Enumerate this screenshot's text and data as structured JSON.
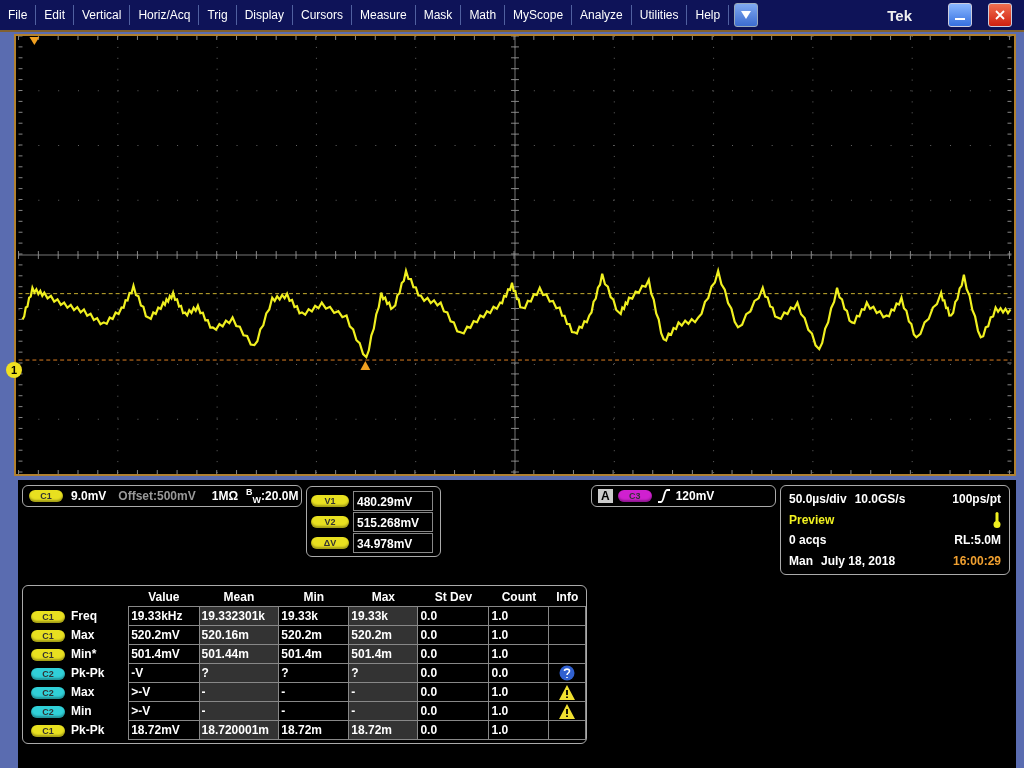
{
  "menu": {
    "items": [
      "File",
      "Edit",
      "Vertical",
      "Horiz/Acq",
      "Trig",
      "Display",
      "Cursors",
      "Measure",
      "Mask",
      "Math",
      "MyScope",
      "Analyze",
      "Utilities",
      "Help"
    ],
    "brand": "Tek"
  },
  "scope": {
    "reference_marker": "1"
  },
  "channel": {
    "chip": "C1",
    "color": "#e8e020",
    "scale": "9.0mV",
    "offset": "Offset:500mV",
    "impedance": "1MΩ",
    "bandwidth": "$^{B}$$_{W}$:20.0M"
  },
  "cursors": [
    {
      "chip": "V1",
      "value": "480.29mV"
    },
    {
      "chip": "V2",
      "value": "515.268mV"
    },
    {
      "chip": "ΔV",
      "value": "34.978mV"
    }
  ],
  "trigger": {
    "source": "A",
    "chip": "C3",
    "color": "#d020d0",
    "level": "120mV"
  },
  "horizontal": {
    "scale": "50.0µs/div",
    "sample_rate": "10.0GS/s",
    "resolution": "100ps/pt",
    "state": "Preview",
    "acquisitions": "0 acqs",
    "record_length": "RL:5.0M",
    "mode": "Man",
    "date": "July 18, 2018",
    "time": "16:00:29"
  },
  "measurements": {
    "columns": [
      "Value",
      "Mean",
      "Min",
      "Max",
      "St Dev",
      "Count",
      "Info"
    ],
    "rows": [
      {
        "chip": "C1",
        "color": "#e8e020",
        "name": "Freq",
        "cells": [
          "19.33kHz",
          "19.332301k",
          "19.33k",
          "19.33k",
          "0.0",
          "1.0"
        ],
        "kind": "plain"
      },
      {
        "chip": "C1",
        "color": "#e8e020",
        "name": "Max",
        "cells": [
          "520.2mV",
          "520.16m",
          "520.2m",
          "520.2m",
          "0.0",
          "1.0"
        ],
        "kind": "plain"
      },
      {
        "chip": "C1",
        "color": "#e8e020",
        "name": "Min*",
        "cells": [
          "501.4mV",
          "501.44m",
          "501.4m",
          "501.4m",
          "0.0",
          "1.0"
        ],
        "kind": "plain"
      },
      {
        "chip": "C2",
        "color": "#30d0d8",
        "name": "Pk-Pk",
        "cells": [
          "-V",
          "?",
          "?",
          "?",
          "0.0",
          "0.0"
        ],
        "kind": "question"
      },
      {
        "chip": "C2",
        "color": "#30d0d8",
        "name": "Max",
        "cells": [
          ">-V",
          "-",
          "-",
          "-",
          "0.0",
          "1.0"
        ],
        "kind": "warning"
      },
      {
        "chip": "C2",
        "color": "#30d0d8",
        "name": "Min",
        "cells": [
          ">-V",
          "-",
          "-",
          "-",
          "0.0",
          "1.0"
        ],
        "kind": "warning"
      },
      {
        "chip": "C1",
        "color": "#e8e020",
        "name": "Pk-Pk",
        "cells": [
          "18.72mV",
          "18.720001m",
          "18.72m",
          "18.72m",
          "0.0",
          "1.0"
        ],
        "kind": "plain"
      }
    ]
  }
}
